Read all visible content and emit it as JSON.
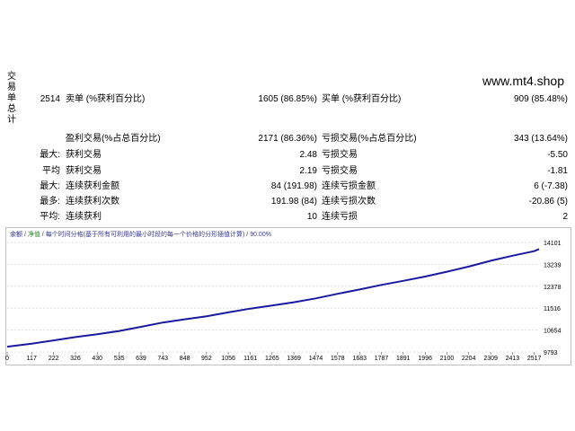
{
  "side_title": "交易单总计",
  "watermark": "www.mt4.shop",
  "rows": [
    {
      "pre": "2514",
      "l1": "卖单 (%获利百分比)",
      "v1": "1605 (86.85%)",
      "l2": "买单 (%获利百分比)",
      "v2": "909 (85.48%)"
    },
    {
      "pre": "",
      "l1": "盈利交易(%占总百分比)",
      "v1": "2171 (86.36%)",
      "l2": "亏损交易(%占总百分比)",
      "v2": "343 (13.64%)"
    },
    {
      "pre": "最大:",
      "l1": "获利交易",
      "v1": "2.48",
      "l2": "亏损交易",
      "v2": "-5.50"
    },
    {
      "pre": "平均",
      "l1": "获利交易",
      "v1": "2.19",
      "l2": "亏损交易",
      "v2": "-1.81"
    },
    {
      "pre": "最大:",
      "l1": "连续获利金额",
      "v1": "84 (191.98)",
      "l2": "连续亏损金额",
      "v2": "6 (-7.38)"
    },
    {
      "pre": "最多:",
      "l1": "连续获利次数",
      "v1": "191.98 (84)",
      "l2": "连续亏损次数",
      "v2": "-20.86 (5)"
    },
    {
      "pre": "平均:",
      "l1": "连续获利",
      "v1": "10",
      "l2": "连续亏损",
      "v2": "2"
    }
  ],
  "chart_legend": {
    "part1": "余额",
    "part2": "净值",
    "part3": "每个时间分格(基于所有可利用的最小时段的每一个价格的分形插值计算)",
    "part4": "90.00%"
  },
  "colors": {
    "line": "#1a1aa0",
    "grid": "#c8c8c8",
    "border": "#c0c0c0"
  },
  "chart_data": {
    "type": "line",
    "title": "",
    "xlabel": "",
    "ylabel": "",
    "x_ticks": [
      0,
      117,
      222,
      326,
      430,
      535,
      639,
      743,
      848,
      952,
      1056,
      1161,
      1265,
      1369,
      1474,
      1578,
      1683,
      1787,
      1891,
      1996,
      2100,
      2204,
      2309,
      2413,
      2517
    ],
    "y_ticks": [
      9793,
      10654,
      11516,
      12378,
      13239,
      14101
    ],
    "xlim": [
      0,
      2540
    ],
    "ylim": [
      9793,
      14101
    ],
    "series": [
      {
        "x": [
          0,
          117,
          222,
          326,
          430,
          535,
          639,
          743,
          848,
          952,
          1056,
          1161,
          1265,
          1369,
          1474,
          1578,
          1683,
          1787,
          1891,
          1996,
          2100,
          2204,
          2309,
          2413,
          2517,
          2540
        ],
        "values": [
          10000,
          10120,
          10250,
          10380,
          10490,
          10620,
          10780,
          10950,
          11080,
          11200,
          11350,
          11500,
          11620,
          11750,
          11900,
          12080,
          12250,
          12430,
          12590,
          12760,
          12950,
          13150,
          13380,
          13580,
          13760,
          13840
        ]
      }
    ]
  }
}
